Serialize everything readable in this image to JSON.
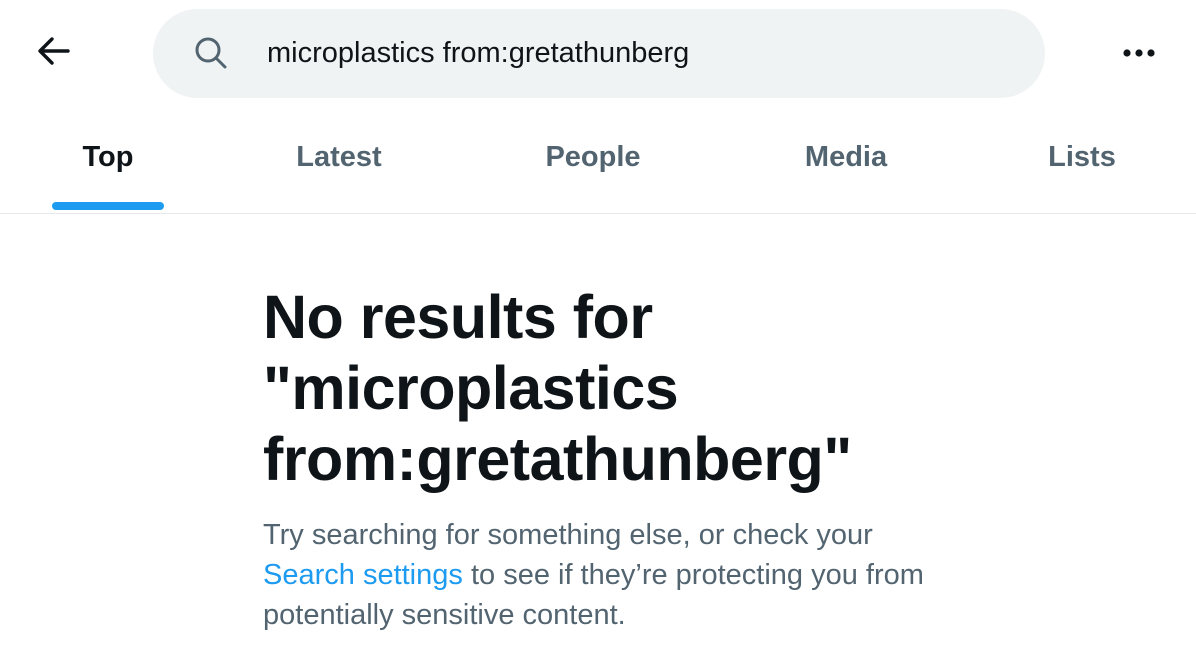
{
  "header": {
    "back_icon": "arrow-left-icon",
    "search": {
      "icon": "search-icon",
      "value": "microplastics from:gretathunberg",
      "placeholder": "Search"
    },
    "more_icon": "more-horizontal-icon"
  },
  "tabs": [
    {
      "label": "Top",
      "active": true
    },
    {
      "label": "Latest",
      "active": false
    },
    {
      "label": "People",
      "active": false
    },
    {
      "label": "Media",
      "active": false
    },
    {
      "label": "Lists",
      "active": false
    }
  ],
  "empty_state": {
    "title": "No results for\n\"microplastics\nfrom:gretathunberg\"",
    "body_prefix": "Try searching for something else, or check your ",
    "link_text": "Search settings",
    "body_suffix": " to see if they’re protecting you from potentially sensitive content."
  },
  "colors": {
    "accent": "#1d9bf0",
    "text_primary": "#0f1419",
    "text_secondary": "#536471",
    "search_bg": "#eff3f4"
  }
}
